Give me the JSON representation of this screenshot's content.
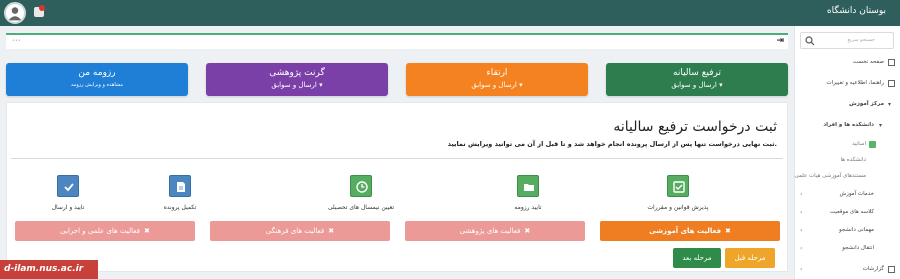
{
  "topbar": {
    "title": "بوستان دانشگاه"
  },
  "sidebar": {
    "search_placeholder": "جستجو سریع",
    "items": [
      {
        "label": "صفحه نخست"
      },
      {
        "label": "راهنما، اطلاعیه و تغییرات"
      },
      {
        "label": "مرکز آموزش"
      },
      {
        "label": "دانشکده ها و افراد"
      },
      {
        "label": "اساتید"
      },
      {
        "label": "دانشکده ها"
      },
      {
        "label": "مستندهای آموزشی هیات علمی"
      },
      {
        "label": "خدمات آموزش"
      },
      {
        "label": "کلاسه های موقعیت"
      },
      {
        "label": "مهمانی دانشجو"
      },
      {
        "label": "انتقال دانشجو"
      },
      {
        "label": "گزارشات"
      }
    ]
  },
  "address_bar": {
    "text": "•••"
  },
  "cards": [
    {
      "title": "ترفیع سالیانه",
      "sub": "ارسال و سوابق ▾",
      "color": "#2e7d4f"
    },
    {
      "title": "ارتقاء",
      "sub": "ارسال و سوابق ▾",
      "color": "#f58220"
    },
    {
      "title": "گرنت پژوهشی",
      "sub": "ارسال و سوابق ▾",
      "color": "#7b3fa8"
    },
    {
      "title": "رزومه من",
      "sub": "مشاهده و ویرایش رزومه",
      "color": "#1f7fd6"
    }
  ],
  "panel": {
    "heading": "ثبت درخواست ترفیع سالیانه",
    "subline": "ثبت نهایی درخواست تنها پس از ارسال پرونده انجام خواهد شد و تا قبل از آن می توانید ویرایش نمایید."
  },
  "steps": [
    {
      "label": "پذیرش قوانین و مقررات",
      "icon": "check-square-icon"
    },
    {
      "label": "تایید رزومه",
      "icon": "folder-open-icon"
    },
    {
      "label": "تعیین نیمسال های تحصیلی",
      "icon": "clock-icon"
    },
    {
      "label": "تکمیل پرونده",
      "icon": "file-icon"
    },
    {
      "label": "تایید و ارسال",
      "icon": "check-icon"
    }
  ],
  "activities": [
    {
      "label": "فعالیت های آموزشی",
      "x": "✖"
    },
    {
      "label": "فعالیت های پژوهشی",
      "x": "✖"
    },
    {
      "label": "فعالیت های فرهنگی",
      "x": "✖"
    },
    {
      "label": "فعالیت های علمی و اجرایی",
      "x": "✖"
    }
  ],
  "buttons": {
    "prev": "مرحله قبل",
    "next": "مرحله بعد"
  },
  "watermark": {
    "text": "d-ilam.nus.ac.ir"
  }
}
